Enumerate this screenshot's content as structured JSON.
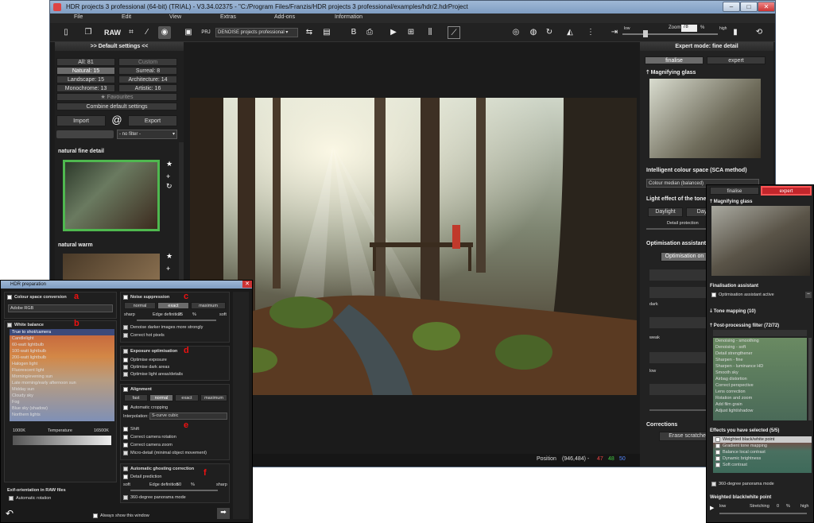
{
  "window": {
    "title": "HDR projects 3 professional (64-bit) (TRIAL) - V3.34.02375 - \"C:/Program Files/Franzis/HDR projects 3 professional/examples/hdr/2.hdrProject"
  },
  "menu": [
    "File",
    "Edit",
    "View",
    "Extras",
    "Add-ons",
    "Information"
  ],
  "toolbar": {
    "denoise_select": "DENOISE projects professional",
    "zoom_label": "Zoom",
    "zoom_value": "78",
    "zoom_unit": "%",
    "low": "low",
    "high": "high"
  },
  "left": {
    "header": ">> Default settings <<",
    "filters": [
      {
        "label": "All: 81"
      },
      {
        "label": "Custom"
      },
      {
        "label": "Natural: 15"
      },
      {
        "label": "Surreal: 8"
      },
      {
        "label": "Landscape: 15"
      },
      {
        "label": "Architecture: 14"
      },
      {
        "label": "Monochrome: 13"
      },
      {
        "label": "Artistic: 16"
      }
    ],
    "favourites": "Favourites",
    "combine": "Combine default settings",
    "import": "Import",
    "export": "Export",
    "filter_select": "- no filter -",
    "preset1": "natural fine detail",
    "preset2": "natural warm"
  },
  "status": {
    "position_label": "Position",
    "position_value": "(946,484) -",
    "r": "47",
    "g": "48",
    "b": "50"
  },
  "right": {
    "header": "Expert mode: fine detail",
    "tab_finalise": "finalise",
    "tab_expert": "expert",
    "magnifier": "Magnifying glass",
    "sca_title": "Intelligent colour space (SCA method)",
    "sca_value": "Colour median (balanced)",
    "light_title": "Light effect of the tone",
    "daylight": "Daylight",
    "day2": "Day",
    "detail_prot": "Detail protection",
    "optim": "Optimisation assistant",
    "optim_on": "Optimisation on",
    "dark": "dark",
    "weak": "weak",
    "low": "low",
    "corrections": "Corrections",
    "erase": "Erase scratches/se"
  },
  "prep": {
    "title": "HDR preparation",
    "colour_space": "Colour space conversion",
    "colour_value": "Adobe RGB",
    "white_balance": "White balance",
    "wb_items": [
      "True to shot/camera",
      "Candlelight",
      "60-watt lightbulb",
      "100-watt lightbulb",
      "200-watt lightbulb",
      "Halogen light",
      "Fluorescent light",
      "Morning/evening sun",
      "Late morning/early afternoon sun",
      "Midday sun",
      "Cloudy sky",
      "Fog",
      "Blue sky (shadow)",
      "Northern lights"
    ],
    "temp_min": "1000K",
    "temp_label": "Temperature",
    "temp_max": "16500K",
    "exif": "Exif-orientation in RAW files",
    "auto_rot": "Automatic rotation",
    "noise": "Noise suppression",
    "noise_opts": [
      "normal",
      "exact",
      "maximum"
    ],
    "sharp": "sharp",
    "edge": "Edge definition",
    "edge_val": "25",
    "pct": "%",
    "soft": "soft",
    "denoise_dark": "Denoise darker images more strongly",
    "hot_pixels": "Correct hot pixels",
    "expo": "Exposure optimisation",
    "expo_items": [
      "Optimise exposure",
      "Optimise dark areas",
      "Optimise light areas/details"
    ],
    "align": "Alignment",
    "align_opts": [
      "fast",
      "normal",
      "exact",
      "maximum"
    ],
    "auto_crop": "Automatic cropping",
    "interp": "Interpolation:",
    "interp_val": "S-curve cubic",
    "shift": "Shift",
    "rot": "Correct camera rotation",
    "zoom": "Correct camera zoom",
    "micro": "Micro-detail (minimal object movement)",
    "ghost": "Automatic ghosting correction",
    "detail_pred": "Detail prediction",
    "edge2": "Edge definition",
    "edge2_val": "50",
    "pano": "360-degree panorama mode",
    "always": "Always show this window",
    "letters": [
      "a",
      "b",
      "c",
      "d",
      "e",
      "f"
    ]
  },
  "expert": {
    "tab_finalise": "finalise",
    "tab_expert": "expert",
    "magnifier": "Magnifying glass",
    "final_assist": "Finalisation assistant",
    "optim_active": "Optimisation assistant active",
    "tone": "Tone mapping (10)",
    "post": "Post-processing filter (72/72)",
    "filters": [
      "Denoising - smoothing",
      "Denoising - soft",
      "Detail strengthener",
      "Sharpen - fine",
      "Sharpen - luminance HD",
      "Smooth sky",
      "Airbag distortion",
      "Correct perspective",
      "Lens correction",
      "Rotation and zoom",
      "Add film grain",
      "Adjust light/shadow"
    ],
    "selected": "Effects you have selected (5/5)",
    "sel_items": [
      "Weighted black/white point",
      "Gradient tone mapping",
      "Balance local contrast",
      "Dynamic brightness",
      "Soft contrast"
    ],
    "pano": "360-degree panorama mode",
    "wbp": "Weighted black/white point",
    "low": "low",
    "stretch": "Stretching",
    "stretch_val": "0",
    "pct": "%",
    "high": "high"
  },
  "colors": {
    "accent_green": "#4fb84f",
    "wb_selected": "#3d4a7a",
    "expert_red": "#c2262b"
  }
}
